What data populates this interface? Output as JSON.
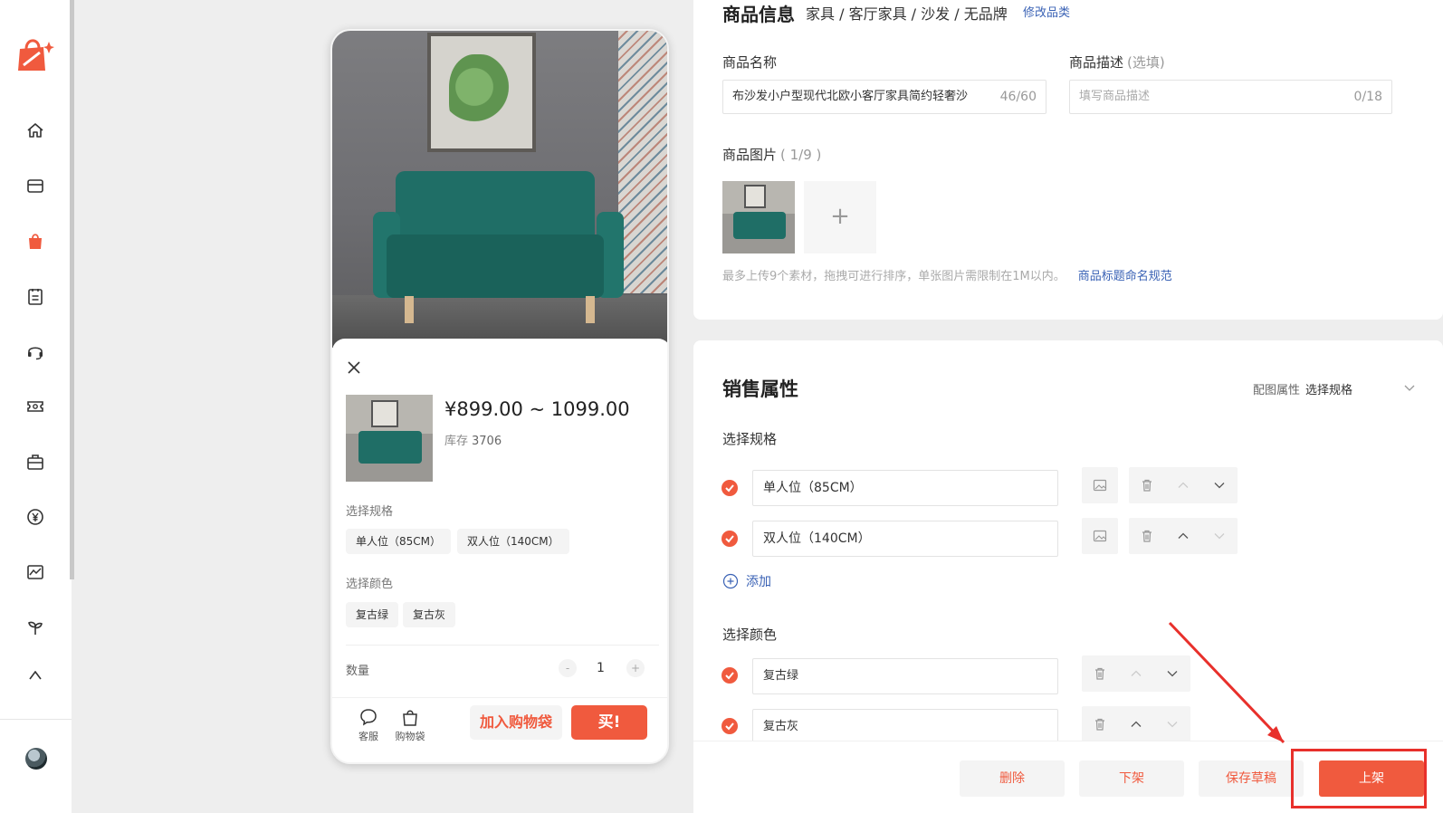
{
  "colors": {
    "accent": "#f05a3e",
    "link": "#3a62b5",
    "annotation": "#e8302b"
  },
  "sidebar": {
    "items": [
      {
        "name": "home-icon"
      },
      {
        "name": "store-icon"
      },
      {
        "name": "bag-icon"
      },
      {
        "name": "clipboard-icon"
      },
      {
        "name": "headset-icon"
      },
      {
        "name": "ticket-icon"
      },
      {
        "name": "briefcase-icon"
      },
      {
        "name": "yuan-icon"
      },
      {
        "name": "chart-icon"
      },
      {
        "name": "sprout-icon"
      }
    ]
  },
  "preview": {
    "price": "¥899.00 ~ 1099.00",
    "stock_label": "库存",
    "stock_value": "3706",
    "spec_label": "选择规格",
    "spec_options": [
      "单人位（85CM）",
      "双人位（140CM）"
    ],
    "color_label": "选择颜色",
    "color_options": [
      "复古绿",
      "复古灰"
    ],
    "qty_label": "数量",
    "qty_minus": "-",
    "qty_value": "1",
    "qty_plus": "+",
    "service_label": "客服",
    "bag_label": "购物袋",
    "add_cart_label": "加入购物袋",
    "buy_label": "买!"
  },
  "info": {
    "title": "商品信息",
    "category": "家具 / 客厅家具 / 沙发 / 无品牌",
    "change_category": "修改品类",
    "name_label": "商品名称",
    "name_value": "布沙发小户型现代北欧小客厅家具简约轻奢沙",
    "name_count": "46/60",
    "desc_label": "商品描述",
    "desc_optional": "(选填)",
    "desc_placeholder": "填写商品描述",
    "desc_count": "0/18",
    "images_label": "商品图片",
    "images_count": "( 1/9 )",
    "add_image": "+",
    "hint": "最多上传9个素材，拖拽可进行排序，单张图片需限制在1M以内。",
    "hint_link": "商品标题命名规范"
  },
  "sales": {
    "title": "销售属性",
    "ctrl_label": "配图属性",
    "ctrl_value": "选择规格",
    "spec_label": "选择规格",
    "specs": [
      "单人位（85CM）",
      "双人位（140CM）"
    ],
    "add_label": "添加",
    "color_label": "选择颜色",
    "colors": [
      "复古绿",
      "复古灰"
    ]
  },
  "actions": {
    "delete": "删除",
    "unlist": "下架",
    "save_draft": "保存草稿",
    "list": "上架"
  }
}
